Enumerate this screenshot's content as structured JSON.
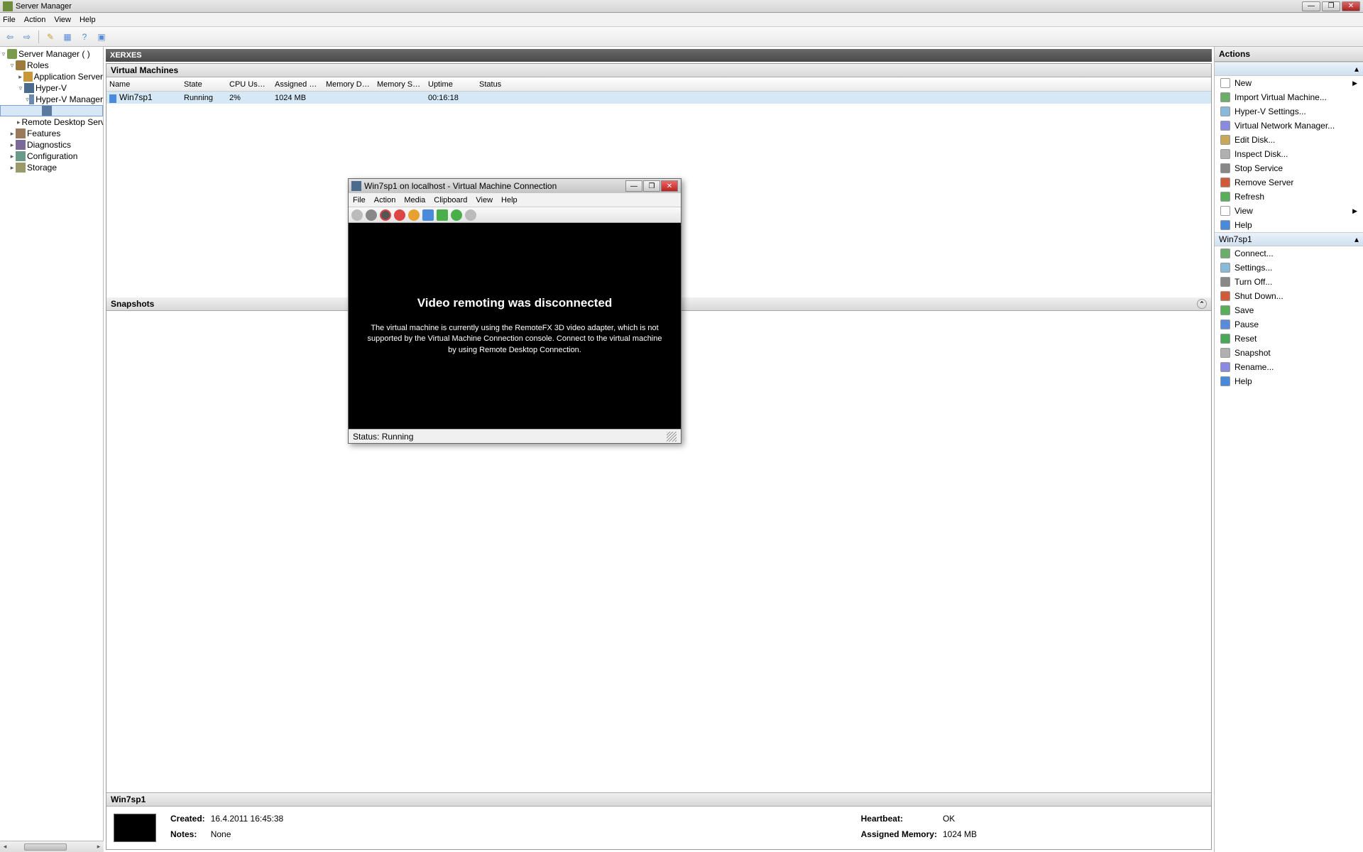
{
  "titlebar": {
    "title": "Server Manager"
  },
  "menubar": [
    "File",
    "Action",
    "View",
    "Help"
  ],
  "tree": {
    "root": "Server Manager (              )",
    "nodes": [
      {
        "label": "Roles",
        "indent": 1,
        "toggle": "▿",
        "icon": "i-roles"
      },
      {
        "label": "Application Server",
        "indent": 2,
        "toggle": "▸",
        "icon": "i-app"
      },
      {
        "label": "Hyper-V",
        "indent": 2,
        "toggle": "▿",
        "icon": "i-hyperv"
      },
      {
        "label": "Hyper-V Manager",
        "indent": 3,
        "toggle": "▿",
        "icon": "i-mgr"
      },
      {
        "label": "",
        "indent": 4,
        "toggle": "",
        "icon": "i-host",
        "selected": true
      },
      {
        "label": "Remote Desktop Services",
        "indent": 2,
        "toggle": "▸",
        "icon": "i-rds"
      },
      {
        "label": "Features",
        "indent": 1,
        "toggle": "▸",
        "icon": "i-feat"
      },
      {
        "label": "Diagnostics",
        "indent": 1,
        "toggle": "▸",
        "icon": "i-diag"
      },
      {
        "label": "Configuration",
        "indent": 1,
        "toggle": "▸",
        "icon": "i-conf"
      },
      {
        "label": "Storage",
        "indent": 1,
        "toggle": "▸",
        "icon": "i-store"
      }
    ]
  },
  "center": {
    "header": "XERXES",
    "vm_title": "Virtual Machines",
    "columns": [
      "Name",
      "State",
      "CPU Usage",
      "Assigned Memory",
      "Memory Demand",
      "Memory Status",
      "Uptime",
      "Status"
    ],
    "rows": [
      {
        "name": "Win7sp1",
        "state": "Running",
        "cpu": "2%",
        "amem": "1024 MB",
        "dem": "",
        "mstat": "",
        "uptime": "00:16:18",
        "status": ""
      }
    ],
    "snapshots_title": "Snapshots",
    "details_title": "Win7sp1",
    "details": {
      "created_k": "Created:",
      "created_v": "16.4.2011 16:45:38",
      "notes_k": "Notes:",
      "notes_v": "None",
      "heartbeat_k": "Heartbeat:",
      "heartbeat_v": "OK",
      "amem_k": "Assigned Memory:",
      "amem_v": "1024 MB"
    }
  },
  "actions": {
    "title": "Actions",
    "group1_header": "",
    "group1": [
      {
        "label": "New",
        "arrow": true,
        "color": "#fff"
      },
      {
        "label": "Import Virtual Machine...",
        "color": "#6aae6a"
      },
      {
        "label": "Hyper-V Settings...",
        "color": "#8abada"
      },
      {
        "label": "Virtual Network Manager...",
        "color": "#8a8ae0"
      },
      {
        "label": "Edit Disk...",
        "color": "#c8a858"
      },
      {
        "label": "Inspect Disk...",
        "color": "#b0b0b0"
      },
      {
        "label": "Stop Service",
        "color": "#888"
      },
      {
        "label": "Remove Server",
        "color": "#d05a3a"
      },
      {
        "label": "Refresh",
        "color": "#5aae5a"
      },
      {
        "label": "View",
        "arrow": true,
        "color": "#fff"
      },
      {
        "label": "Help",
        "color": "#4a8ada"
      }
    ],
    "group2_header": "Win7sp1",
    "group2": [
      {
        "label": "Connect...",
        "color": "#6aae6a"
      },
      {
        "label": "Settings...",
        "color": "#8abada"
      },
      {
        "label": "Turn Off...",
        "color": "#888"
      },
      {
        "label": "Shut Down...",
        "color": "#d05a3a"
      },
      {
        "label": "Save",
        "color": "#5aae5a"
      },
      {
        "label": "Pause",
        "color": "#5a8ada"
      },
      {
        "label": "Reset",
        "color": "#48a858"
      },
      {
        "label": "Snapshot",
        "color": "#b0b0b0"
      },
      {
        "label": "Rename...",
        "color": "#8a8ae0"
      },
      {
        "label": "Help",
        "color": "#4a8ada"
      }
    ]
  },
  "vmc": {
    "title": "Win7sp1 on localhost - Virtual Machine Connection",
    "menus": [
      "File",
      "Action",
      "Media",
      "Clipboard",
      "View",
      "Help"
    ],
    "heading": "Video remoting was disconnected",
    "body": "The virtual machine is currently using the RemoteFX 3D video adapter, which is not supported by the Virtual Machine Connection console. Connect to the virtual machine by using Remote Desktop Connection.",
    "status": "Status: Running"
  }
}
